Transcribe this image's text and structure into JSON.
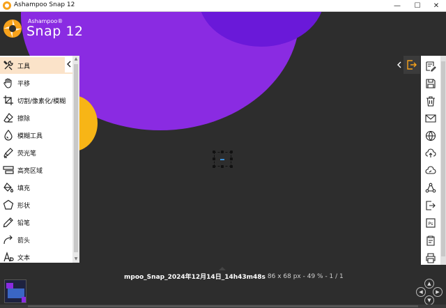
{
  "window": {
    "title": "Ashampoo Snap 12",
    "minimize_glyph": "—",
    "maximize_glyph": "☐",
    "close_glyph": "✕"
  },
  "logo": {
    "brand": "Ashampoo®",
    "product": "Snap 12"
  },
  "tools": [
    {
      "label": "工具",
      "icon": "tools-icon",
      "active": true
    },
    {
      "label": "平移",
      "icon": "hand-icon"
    },
    {
      "label": "切割/像素化/模糊",
      "icon": "crop-icon"
    },
    {
      "label": "擦除",
      "icon": "eraser-icon"
    },
    {
      "label": "模糊工具",
      "icon": "blur-drop-icon"
    },
    {
      "label": "荧光笔",
      "icon": "highlighter-icon"
    },
    {
      "label": "高亮区域",
      "icon": "highlight-area-icon"
    },
    {
      "label": "填充",
      "icon": "fill-bucket-icon"
    },
    {
      "label": "形状",
      "icon": "pentagon-icon"
    },
    {
      "label": "铅笔",
      "icon": "pencil-icon"
    },
    {
      "label": "箭头",
      "icon": "arrow-icon"
    },
    {
      "label": "文本",
      "icon": "text-icon"
    }
  ],
  "right_tools": [
    "edit-notes-icon",
    "save-icon",
    "trash-icon",
    "mail-icon",
    "globe-icon",
    "cloud-upload-icon",
    "cloud-share-icon",
    "share-icon",
    "export-icon",
    "photoshop-icon",
    "clipboard-icon",
    "print-icon"
  ],
  "right_tools_ps_label": "Ps",
  "status": {
    "filename": "mpoo_Snap_2024年12月14日_14h43m48s",
    "info": "86 x 68 px - 49 % - 1 / 1"
  },
  "colors": {
    "accent": "#f7a21b",
    "purple": "#8a2be2",
    "purple_dark": "#6a19d9",
    "yellow": "#f7b516",
    "canvas_bg": "#2d2d2d",
    "active_tool_bg": "#fbe3c9"
  }
}
